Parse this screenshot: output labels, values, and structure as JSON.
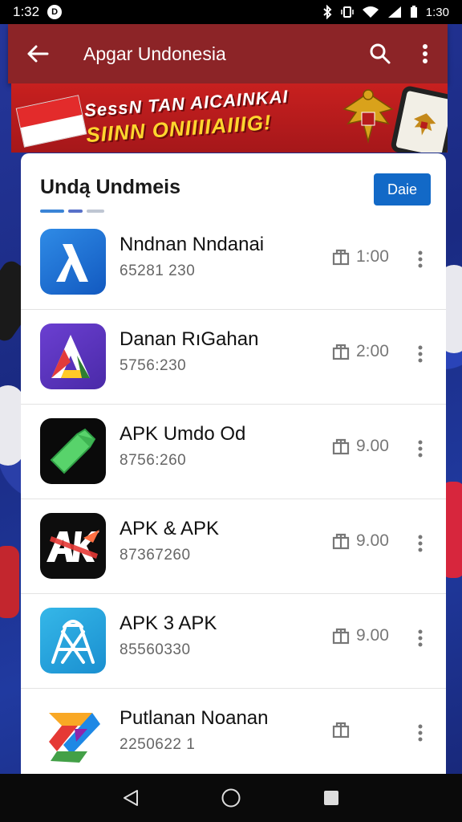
{
  "status_bar": {
    "time": "1:32",
    "notification_glyph": "D",
    "right_text": "1:30"
  },
  "app_bar": {
    "title": "Apgar Undonesia"
  },
  "banner": {
    "line1": "SessN TAN AICAINKAI",
    "line2": "SIINN ONIIIIAIIIG!"
  },
  "section": {
    "title": "Undą Undmeis",
    "button_label": "Daie"
  },
  "apps": [
    {
      "name": "Nndnan Nndanai",
      "sub": "65281 230",
      "action": "1:00",
      "icon": "lambda-icon"
    },
    {
      "name": "Danan RıGahan",
      "sub": "5756:230",
      "action": "2:00",
      "icon": "a-logo-icon"
    },
    {
      "name": "APK Umdo Od",
      "sub": "8756:260",
      "action": "9.00",
      "icon": "green-arrow-icon"
    },
    {
      "name": "APK & APK",
      "sub": "87367260",
      "action": "9.00",
      "icon": "ak-logo-icon"
    },
    {
      "name": "APK 3 APK",
      "sub": "85560330",
      "action": "9.00",
      "icon": "a-outline-icon"
    },
    {
      "name": "Putlanan Noanan",
      "sub": "2250622 1",
      "action": "",
      "icon": "colorful-z-icon"
    }
  ],
  "colors": {
    "app_bar": "#8c2427",
    "accent": "#1269c7",
    "banner": "#c8201f"
  }
}
